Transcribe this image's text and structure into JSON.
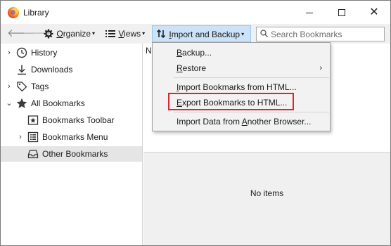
{
  "window": {
    "title": "Library",
    "minimize_glyph": "—",
    "close_glyph": "✕"
  },
  "toolbar": {
    "back_glyph": "🡐",
    "forward_glyph": "🡒",
    "organize": {
      "pre": "",
      "ul": "O",
      "post": "rganize"
    },
    "views": {
      "pre": "",
      "ul": "V",
      "post": "iews"
    },
    "import_backup": {
      "pre": "",
      "ul": "I",
      "post": "mport and Backup"
    },
    "caret": "▾",
    "search_placeholder": "Search Bookmarks"
  },
  "sidebar": {
    "items": [
      {
        "label": "History",
        "icon": "history-clock-icon",
        "expandable": true
      },
      {
        "label": "Downloads",
        "icon": "download-arrow-icon",
        "expandable": false
      },
      {
        "label": "Tags",
        "icon": "tag-icon",
        "expandable": true
      },
      {
        "label": "All Bookmarks",
        "icon": "star-icon",
        "expandable": true,
        "expanded": true
      },
      {
        "label": "Bookmarks Toolbar",
        "icon": "bookmarks-toolbar-icon",
        "expandable": false
      },
      {
        "label": "Bookmarks Menu",
        "icon": "bookmarks-menu-icon",
        "expandable": true
      },
      {
        "label": "Other Bookmarks",
        "icon": "folder-tray-icon",
        "expandable": false,
        "selected": true
      }
    ],
    "twisty_collapsed": "›",
    "twisty_expanded": "⌄"
  },
  "content": {
    "column_header": "N",
    "empty_text": "No items"
  },
  "menu": {
    "items": [
      {
        "pre": "",
        "ul": "B",
        "post": "ackup..."
      },
      {
        "pre": "",
        "ul": "R",
        "post": "estore"
      },
      {
        "pre": "",
        "ul": "I",
        "post": "mport Bookmarks from HTML..."
      },
      {
        "pre": "",
        "ul": "E",
        "post": "xport Bookmarks to HTML..."
      },
      {
        "pre": "Import Data from ",
        "ul": "A",
        "post": "nother Browser..."
      }
    ],
    "submenu_arrow": "›"
  },
  "colors": {
    "highlight_box": "#e0242f",
    "toolbar_active": "#cce2f6",
    "selected_row": "#e5e5e5"
  }
}
